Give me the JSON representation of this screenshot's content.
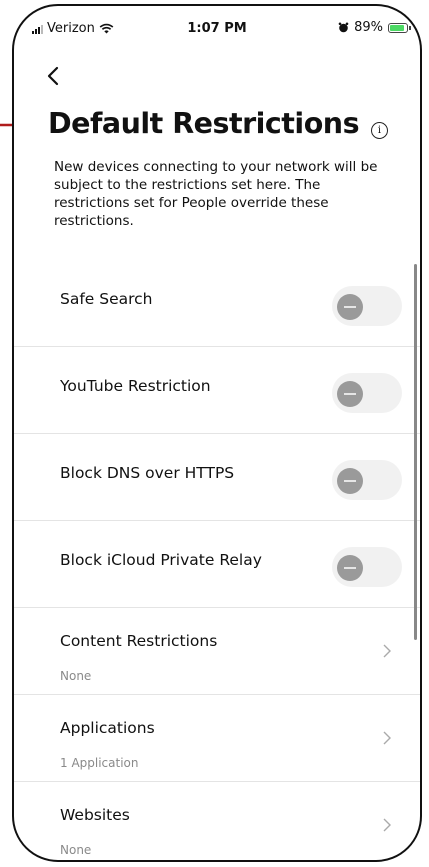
{
  "status_bar": {
    "carrier": "Verizon",
    "time": "1:07 PM",
    "battery": "89%",
    "battery_level": 0.89,
    "icons": [
      "signal-icon",
      "wifi-icon",
      "alarm-icon",
      "battery-charging-icon"
    ]
  },
  "header": {
    "back_icon": "chevron-left-icon",
    "title": "Default Restrictions",
    "info_icon": "info-icon",
    "description": "New devices connecting to your network will be subject to the restrictions set here. The restrictions set for People override these restrictions."
  },
  "toggles": [
    {
      "label": "Safe Search",
      "state": "off"
    },
    {
      "label": "YouTube Restriction",
      "state": "off"
    },
    {
      "label": "Block DNS over HTTPS",
      "state": "off"
    },
    {
      "label": "Block iCloud Private Relay",
      "state": "off"
    }
  ],
  "nav_items": [
    {
      "label": "Content Restrictions",
      "value": "None"
    },
    {
      "label": "Applications",
      "value": "1 Application"
    },
    {
      "label": "Websites",
      "value": "None"
    }
  ],
  "colors": {
    "annotation_arrow": "#b01c1c",
    "toggle_track": "#f1f1f1",
    "toggle_knob": "#9a9a9a",
    "battery_fill": "#4cd964"
  }
}
